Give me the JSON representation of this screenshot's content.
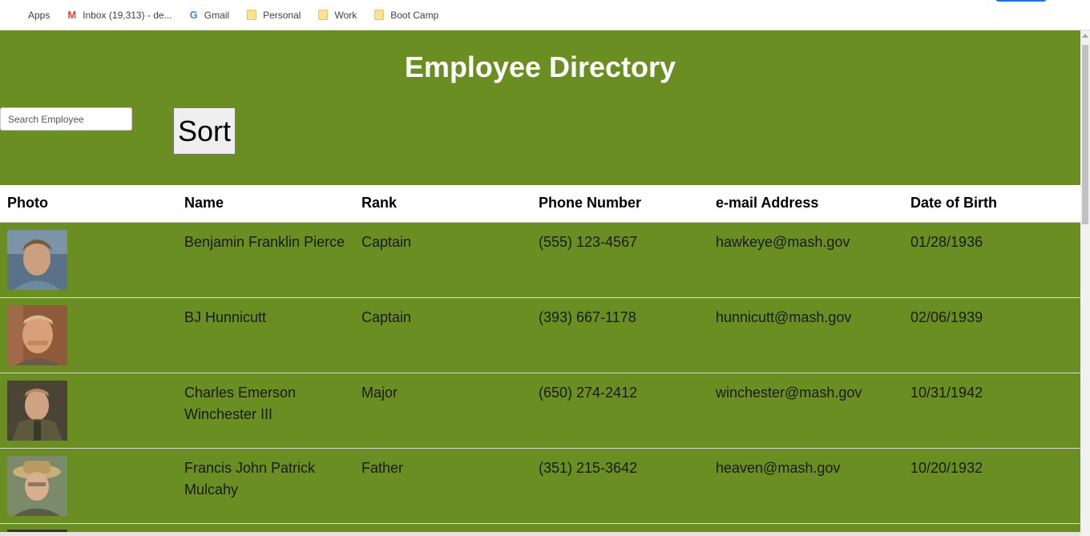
{
  "bookmarks": {
    "apps": "Apps",
    "inbox": "Inbox (19,313) - de...",
    "gmail": "Gmail",
    "personal": "Personal",
    "work": "Work",
    "bootcamp": "Boot Camp"
  },
  "header": {
    "title": "Employee Directory",
    "search_placeholder": "Search Employee",
    "sort_label": "Sort"
  },
  "table": {
    "columns": [
      "Photo",
      "Name",
      "Rank",
      "Phone Number",
      "e-mail Address",
      "Date of Birth"
    ],
    "rows": [
      {
        "name": "Benjamin Franklin Pierce",
        "rank": "Captain",
        "phone": "(555) 123-4567",
        "email": "hawkeye@mash.gov",
        "dob": "01/28/1936"
      },
      {
        "name": "BJ Hunnicutt",
        "rank": "Captain",
        "phone": "(393) 667-1178",
        "email": "hunnicutt@mash.gov",
        "dob": "02/06/1939"
      },
      {
        "name": "Charles Emerson Winchester III",
        "rank": "Major",
        "phone": "(650) 274-2412",
        "email": "winchester@mash.gov",
        "dob": "10/31/1942"
      },
      {
        "name": "Francis John Patrick Mulcahy",
        "rank": "Father",
        "phone": "(351) 215-3642",
        "email": "heaven@mash.gov",
        "dob": "10/20/1932"
      }
    ]
  },
  "colors": {
    "header_bg": "#6b8e23",
    "row_bg": "#6b8e23"
  }
}
